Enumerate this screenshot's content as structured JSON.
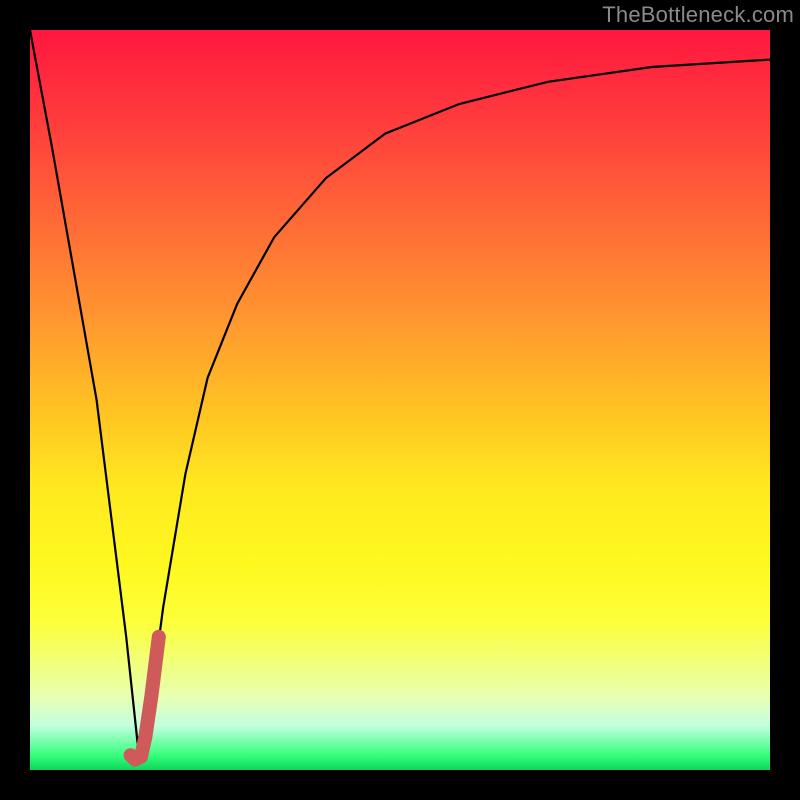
{
  "watermark": "TheBottleneck.com",
  "marker_color": "#cf5a5a",
  "chart_data": {
    "type": "line",
    "title": "",
    "xlabel": "",
    "ylabel": "",
    "xlim": [
      0,
      100
    ],
    "ylim": [
      0,
      100
    ],
    "grid": false,
    "series": [
      {
        "name": "bottleneck-curve",
        "x": [
          0,
          3,
          6,
          9,
          11,
          13,
          14.5,
          16,
          18,
          21,
          24,
          28,
          33,
          40,
          48,
          58,
          70,
          84,
          100
        ],
        "y": [
          100,
          84,
          67,
          50,
          34,
          18,
          4,
          7,
          22,
          40,
          53,
          63,
          72,
          80,
          86,
          90,
          93,
          95,
          96
        ]
      }
    ],
    "marker_hook": {
      "x": [
        13.6,
        14.2,
        15.0,
        15.6,
        16.4,
        17.4
      ],
      "y": [
        2.0,
        1.4,
        1.8,
        4.5,
        10.0,
        18.0
      ]
    }
  }
}
